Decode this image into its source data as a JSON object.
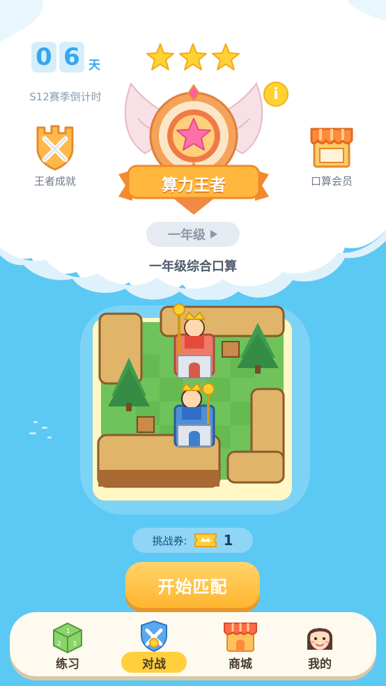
{
  "season": {
    "days_digits": [
      "0",
      "6"
    ],
    "days_unit": "天",
    "countdown_label": "S12赛季倒计时"
  },
  "stars": 3,
  "rank": {
    "title": "算力王者",
    "info_icon": "i"
  },
  "left_entry": {
    "label": "王者成就",
    "icon": "crossed-swords-shield-icon"
  },
  "right_entry": {
    "label": "口算会员",
    "icon": "shop-awning-icon"
  },
  "grade": {
    "label": "一年级"
  },
  "mode": {
    "label": "一年级综合口算"
  },
  "ticket": {
    "label": "挑战券:",
    "count": "1"
  },
  "start_button": {
    "label": "开始匹配"
  },
  "tabs": [
    {
      "label": "练习",
      "icon": "dice-icon",
      "active": false
    },
    {
      "label": "对战",
      "icon": "battle-shield-icon",
      "active": true
    },
    {
      "label": "商城",
      "icon": "shop-icon",
      "active": false
    },
    {
      "label": "我的",
      "icon": "avatar-icon",
      "active": false
    }
  ],
  "colors": {
    "sky": "#5cc8f4",
    "accent": "#34a8ee",
    "button": "#ffb52f",
    "active_tab": "#ffcf3e"
  }
}
